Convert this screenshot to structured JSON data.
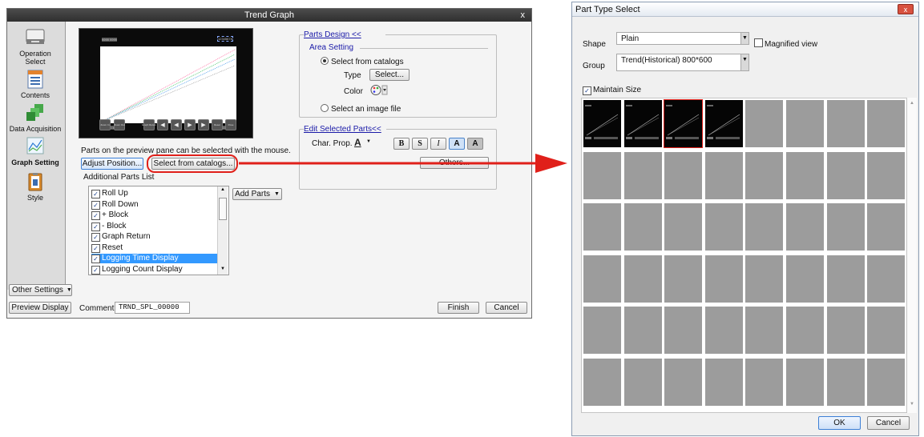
{
  "trend_dialog": {
    "title": "Trend Graph",
    "close_glyph": "x",
    "sidebar": [
      {
        "label": "Operation\nSelect",
        "icon": "keyboard-icon"
      },
      {
        "label": "Contents",
        "icon": "document-icon"
      },
      {
        "label": "Data Acquisition",
        "icon": "stack-icon"
      },
      {
        "label": "Graph Setting",
        "icon": "line-graph-icon"
      },
      {
        "label": "Style",
        "icon": "clipboard-icon"
      }
    ],
    "other_settings": "Other Settings",
    "preview": {
      "top_labels": [
        "9999 9999",
        "12345678"
      ],
      "bottom_left_label": "12345678",
      "bottom_right_label": "12345678",
      "buttons": [
        "Zoom In",
        "Zoom Out",
        "Graph Return",
        "Page",
        "",
        "",
        "",
        "Page",
        "Reset",
        "Pose"
      ]
    },
    "hint": "Parts on the preview pane can be selected with the mouse.",
    "adjust_position": "Adjust Position...",
    "select_from_catalogs_btn": "Select from catalogs...",
    "additional_parts_list": "Additional Parts List",
    "parts": [
      {
        "label": "Roll Up",
        "checked": true,
        "selected": false
      },
      {
        "label": "Roll Down",
        "checked": true,
        "selected": false
      },
      {
        "label": "+ Block",
        "checked": true,
        "selected": false
      },
      {
        "label": "- Block",
        "checked": true,
        "selected": false
      },
      {
        "label": "Graph Return",
        "checked": true,
        "selected": false
      },
      {
        "label": "Reset",
        "checked": true,
        "selected": false
      },
      {
        "label": "Logging Time Display",
        "checked": true,
        "selected": true
      },
      {
        "label": "Logging Count Display",
        "checked": true,
        "selected": false
      }
    ],
    "add_parts": "Add Parts",
    "parts_design": {
      "header": "Parts Design <<",
      "area_setting": "Area Setting",
      "select_from_catalogs": "Select from catalogs",
      "type_label": "Type",
      "select_btn": "Select...",
      "color_label": "Color",
      "select_image_file": "Select an image file"
    },
    "edit_selected": {
      "header": "Edit Selected Parts<<",
      "char_prop": "Char. Prop.",
      "font_btn": "A",
      "style_buttons": [
        "B",
        "S",
        "I",
        "A",
        "A"
      ],
      "others": "Others..."
    },
    "preview_display": "Preview Display",
    "comment_label": "Comment",
    "comment_value": "TRND_SPL_00000",
    "finish": "Finish",
    "cancel": "Cancel"
  },
  "part_type_select": {
    "title": "Part Type Select",
    "close_glyph": "x",
    "shape_label": "Shape",
    "shape_value": "Plain",
    "magnified_view": "Magnified view",
    "group_label": "Group",
    "group_value": "Trend(Historical) 800*600",
    "maintain_size": "Maintain Size",
    "maintain_checked": true,
    "grid_rows": 6,
    "grid_cols": 8,
    "thumbnail_count": 4,
    "selected_index": 2,
    "ok": "OK",
    "cancel": "Cancel"
  },
  "colors": {
    "highlight": "#e0201a",
    "selection": "#3399ff",
    "dark_title": "#3a3a3a"
  }
}
